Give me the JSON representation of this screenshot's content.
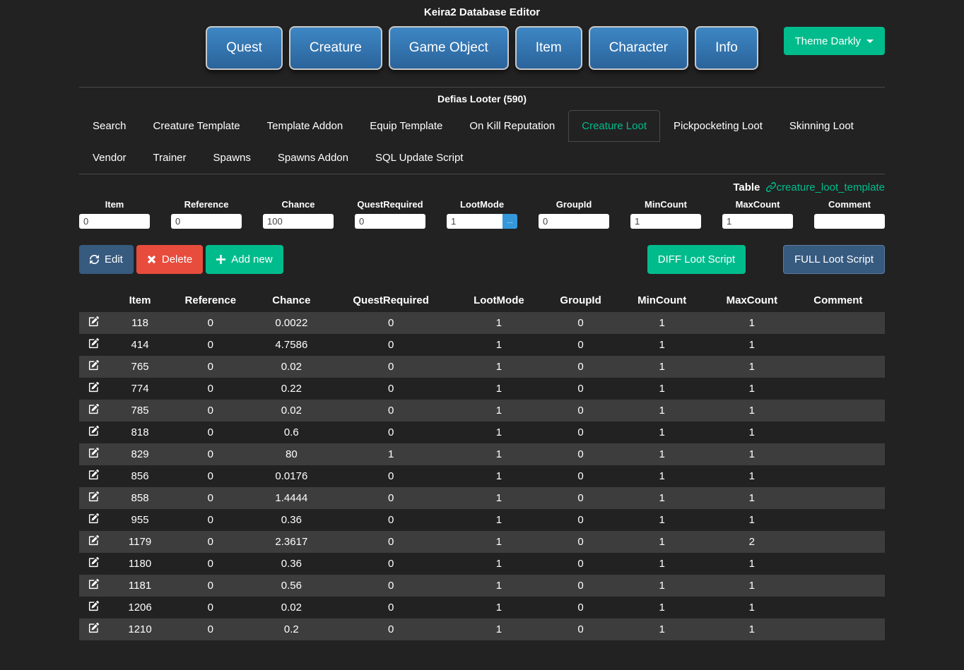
{
  "page": {
    "title": "Keira2 Database Editor"
  },
  "nav": {
    "buttons": [
      {
        "label": "Quest"
      },
      {
        "label": "Creature"
      },
      {
        "label": "Game Object"
      },
      {
        "label": "Item"
      },
      {
        "label": "Character"
      },
      {
        "label": "Info"
      }
    ],
    "theme_button": {
      "label": "Theme Darkly",
      "icon": "caret-down-icon"
    }
  },
  "entity": {
    "title": "Defias Looter (590)"
  },
  "tabs": {
    "items": [
      {
        "label": "Search",
        "active": false
      },
      {
        "label": "Creature Template",
        "active": false
      },
      {
        "label": "Template Addon",
        "active": false
      },
      {
        "label": "Equip Template",
        "active": false
      },
      {
        "label": "On Kill Reputation",
        "active": false
      },
      {
        "label": "Creature Loot",
        "active": true
      },
      {
        "label": "Pickpocketing Loot",
        "active": false
      },
      {
        "label": "Skinning Loot",
        "active": false
      },
      {
        "label": "Vendor",
        "active": false
      },
      {
        "label": "Trainer",
        "active": false
      },
      {
        "label": "Spawns",
        "active": false
      },
      {
        "label": "Spawns Addon",
        "active": false
      },
      {
        "label": "SQL Update Script",
        "active": false
      }
    ]
  },
  "table_heading": {
    "prefix": "Table",
    "link_icon": "link-icon",
    "table_name": "creature_loot_template"
  },
  "form": {
    "fields": [
      {
        "label": "Item",
        "value": "0"
      },
      {
        "label": "Reference",
        "value": "0"
      },
      {
        "label": "Chance",
        "value": "100"
      },
      {
        "label": "QuestRequired",
        "value": "0"
      },
      {
        "label": "LootMode",
        "value": "1",
        "picker_label": "..."
      },
      {
        "label": "GroupId",
        "value": "0"
      },
      {
        "label": "MinCount",
        "value": "1"
      },
      {
        "label": "MaxCount",
        "value": "1"
      },
      {
        "label": "Comment",
        "value": ""
      }
    ]
  },
  "actions": {
    "edit": "Edit",
    "delete": "Delete",
    "add_new": "Add new",
    "diff_script": "DIFF Loot Script",
    "full_script": "FULL Loot Script"
  },
  "table": {
    "headers": [
      "Item",
      "Reference",
      "Chance",
      "QuestRequired",
      "LootMode",
      "GroupId",
      "MinCount",
      "MaxCount",
      "Comment"
    ],
    "row_icon": "edit-row-icon",
    "rows": [
      [
        "118",
        "0",
        "0.0022",
        "0",
        "1",
        "0",
        "1",
        "1",
        ""
      ],
      [
        "414",
        "0",
        "4.7586",
        "0",
        "1",
        "0",
        "1",
        "1",
        ""
      ],
      [
        "765",
        "0",
        "0.02",
        "0",
        "1",
        "0",
        "1",
        "1",
        ""
      ],
      [
        "774",
        "0",
        "0.22",
        "0",
        "1",
        "0",
        "1",
        "1",
        ""
      ],
      [
        "785",
        "0",
        "0.02",
        "0",
        "1",
        "0",
        "1",
        "1",
        ""
      ],
      [
        "818",
        "0",
        "0.6",
        "0",
        "1",
        "0",
        "1",
        "1",
        ""
      ],
      [
        "829",
        "0",
        "80",
        "1",
        "1",
        "0",
        "1",
        "1",
        ""
      ],
      [
        "856",
        "0",
        "0.0176",
        "0",
        "1",
        "0",
        "1",
        "1",
        ""
      ],
      [
        "858",
        "0",
        "1.4444",
        "0",
        "1",
        "0",
        "1",
        "1",
        ""
      ],
      [
        "955",
        "0",
        "0.36",
        "0",
        "1",
        "0",
        "1",
        "1",
        ""
      ],
      [
        "1179",
        "0",
        "2.3617",
        "0",
        "1",
        "0",
        "1",
        "2",
        ""
      ],
      [
        "1180",
        "0",
        "0.36",
        "0",
        "1",
        "0",
        "1",
        "1",
        ""
      ],
      [
        "1181",
        "0",
        "0.56",
        "0",
        "1",
        "0",
        "1",
        "1",
        ""
      ],
      [
        "1206",
        "0",
        "0.02",
        "0",
        "1",
        "0",
        "1",
        "1",
        ""
      ],
      [
        "1210",
        "0",
        "0.2",
        "0",
        "1",
        "0",
        "1",
        "1",
        ""
      ]
    ]
  },
  "colors": {
    "background": "#222222",
    "accent_green": "#00bc8c",
    "primary_blue": "#375a7f",
    "danger_red": "#e74c3c",
    "info_blue": "#3498db",
    "stripe_gray": "#3d3d3d",
    "nav_gradient_top": "#3d87c4",
    "nav_gradient_bottom": "#2b639b"
  }
}
